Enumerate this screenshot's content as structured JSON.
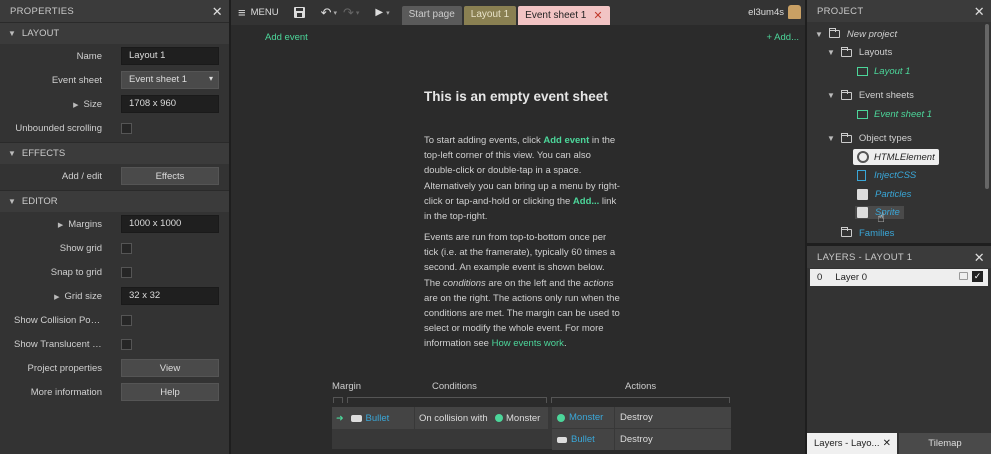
{
  "properties": {
    "title": "PROPERTIES",
    "sections": {
      "layout": "LAYOUT",
      "effects": "EFFECTS",
      "editor": "EDITOR"
    },
    "layout_rows": {
      "name_label": "Name",
      "name_value": "Layout 1",
      "event_sheet_label": "Event sheet",
      "event_sheet_value": "Event sheet 1",
      "size_label": "Size",
      "size_value": "1708 x 960",
      "unbounded_label": "Unbounded scrolling"
    },
    "effects_rows": {
      "add_edit_label": "Add / edit",
      "effects_button": "Effects"
    },
    "editor_rows": {
      "margins_label": "Margins",
      "margins_value": "1000 x 1000",
      "show_grid_label": "Show grid",
      "snap_label": "Snap to grid",
      "grid_size_label": "Grid size",
      "grid_size_value": "32 x 32",
      "collision_label": "Show Collision Polyg...",
      "translucent_label": "Show Translucent In...",
      "project_props_label": "Project properties",
      "view_button": "View",
      "more_info_label": "More information",
      "help_button": "Help"
    }
  },
  "toolbar": {
    "menu_label": "MENU",
    "tabs": [
      "Start page",
      "Layout 1",
      "Event sheet 1"
    ],
    "user": "el3um4s"
  },
  "editor": {
    "add_event_left": "Add event",
    "add_event_right": "+ Add...",
    "heading": "This is an empty event sheet",
    "p1_a": "To start adding events, click ",
    "p1_link": "Add event",
    "p1_b": " in the top-left corner of this view. You can also double-click or double-tap in a space. Alternatively you can bring up a menu by right-click or tap-and-hold or clicking the ",
    "p1_link2": "Add...",
    "p1_c": " link in the top-right.",
    "p2_a": "Events are run from top-to-bottom once per tick (i.e. at the framerate), typically 60 times a second. An example event is shown below. The ",
    "p2_cond": "conditions",
    "p2_b": " are on the left and the ",
    "p2_act": "actions",
    "p2_c": " are on the right. The actions only run when the conditions are met. The margin can be used to select or modify the whole event. For more information see ",
    "p2_link": "How events work",
    "p2_d": ".",
    "example": {
      "margin_header": "Margin",
      "conditions_header": "Conditions",
      "actions_header": "Actions",
      "cond_object": "Bullet",
      "cond_text": "On collision with",
      "cond_target": "Monster",
      "actions": [
        {
          "object": "Monster",
          "action": "Destroy"
        },
        {
          "object": "Bullet",
          "action": "Destroy"
        }
      ]
    }
  },
  "project": {
    "title": "PROJECT",
    "root": "New project",
    "layouts_folder": "Layouts",
    "layout_item": "Layout 1",
    "events_folder": "Event sheets",
    "event_item": "Event sheet 1",
    "objects_folder": "Object types",
    "objects": [
      "HTMLElement",
      "InjectCSS",
      "Particles",
      "Sprite"
    ],
    "families_folder": "Families"
  },
  "layers": {
    "title": "LAYERS - LAYOUT 1",
    "rows": [
      {
        "index": "0",
        "name": "Layer 0"
      }
    ],
    "bottom_tabs": [
      "Layers - Layo...",
      "Tilemap"
    ]
  },
  "colors": {
    "accent": "#4cd69a",
    "active_tab": "#f2c4c4",
    "link_blue": "#3aa7d8"
  }
}
